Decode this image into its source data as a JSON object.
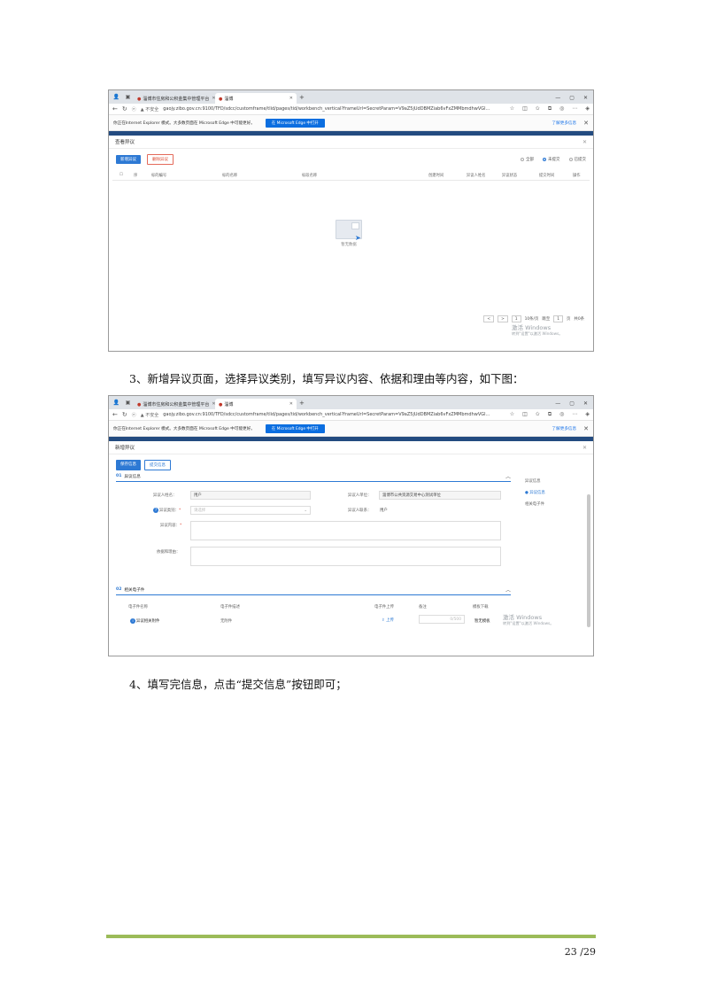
{
  "browser": {
    "tabs": [
      {
        "label": "淄博市住房和公积金集中管理平台",
        "active": false
      },
      {
        "label": "淄博",
        "active": true
      }
    ],
    "new_tab": "+",
    "controls": [
      "—",
      "▢",
      "✕"
    ],
    "security": "不安全",
    "url": "gaojy.zibo.gov.cn:9100/TFD/sdcc/customframe/tlid/pages/tid/workbench_vertical?frameUrl=SecretParam=V9aZ5jUdDBMZiab6vFxZMMbmdhwVGl...",
    "ie_notice": "你正在Internet Explorer 模式。大多数页面在 Microsoft Edge 中可能更好。",
    "ie_button": "在 Microsoft Edge 中打开",
    "ie_link": "了解更多信息"
  },
  "shot1": {
    "title": "查看异议",
    "buttons": {
      "add": "新增异议",
      "delete": "删除异议"
    },
    "radios": [
      {
        "label": "全部",
        "selected": false
      },
      {
        "label": "未提交",
        "selected": true
      },
      {
        "label": "已提交",
        "selected": false
      }
    ],
    "columns": [
      "序",
      "标的编号",
      "标的名称",
      "标段名称",
      "创建时间",
      "异议人姓名",
      "异议状态",
      "提交时间",
      "操作"
    ],
    "empty_text": "暂无数据",
    "pager": {
      "prev": "<",
      "next": ">",
      "current": "1",
      "per_page": "10条/页",
      "goto": "跳至",
      "page_input": "1",
      "page_suffix": "页",
      "total": "共0条"
    },
    "watermark": {
      "title": "激活 Windows",
      "sub": "转到\"设置\"以激活 Windows。"
    }
  },
  "para1": "3、新增异议页面，选择异议类别，填写异议内容、依据和理由等内容，如下图：",
  "shot2": {
    "title": "新增异议",
    "tabs": {
      "save": "保存信息",
      "submit": "提交信息"
    },
    "section1": {
      "num": "01",
      "title": "异议信息"
    },
    "fields": {
      "applicant_label": "异议人姓名：",
      "applicant_value": "用户",
      "unit_label": "异议人单位：",
      "unit_value": "淄博市公共资源交易中心测试单位",
      "category_label": "异议类别：",
      "category_placeholder": "请选择",
      "contact_label": "异议人联系：",
      "contact_value": "用户",
      "content_label": "异议内容：",
      "basis_label": "依据和理由："
    },
    "anchors": [
      {
        "label": "异议信息",
        "active": false
      },
      {
        "label": "异议信息",
        "active": true
      },
      {
        "label": "相关电子件",
        "active": false
      }
    ],
    "section2": {
      "num": "02",
      "title": "相关电子件"
    },
    "attach_columns": [
      "电子件名称",
      "电子件描述",
      "电子件上传",
      "备注",
      "模板下载"
    ],
    "attach_row": {
      "name": "异议相关附件",
      "desc": "无附件",
      "upload": "上传",
      "note": "0/500",
      "download": "暂无模板"
    },
    "watermark": {
      "title": "激活 Windows",
      "sub": "转到\"设置\"以激活 Windows。"
    }
  },
  "para2": "4、填写完信息，点击“提交信息”按钮即可；",
  "page_number": "23 /29"
}
